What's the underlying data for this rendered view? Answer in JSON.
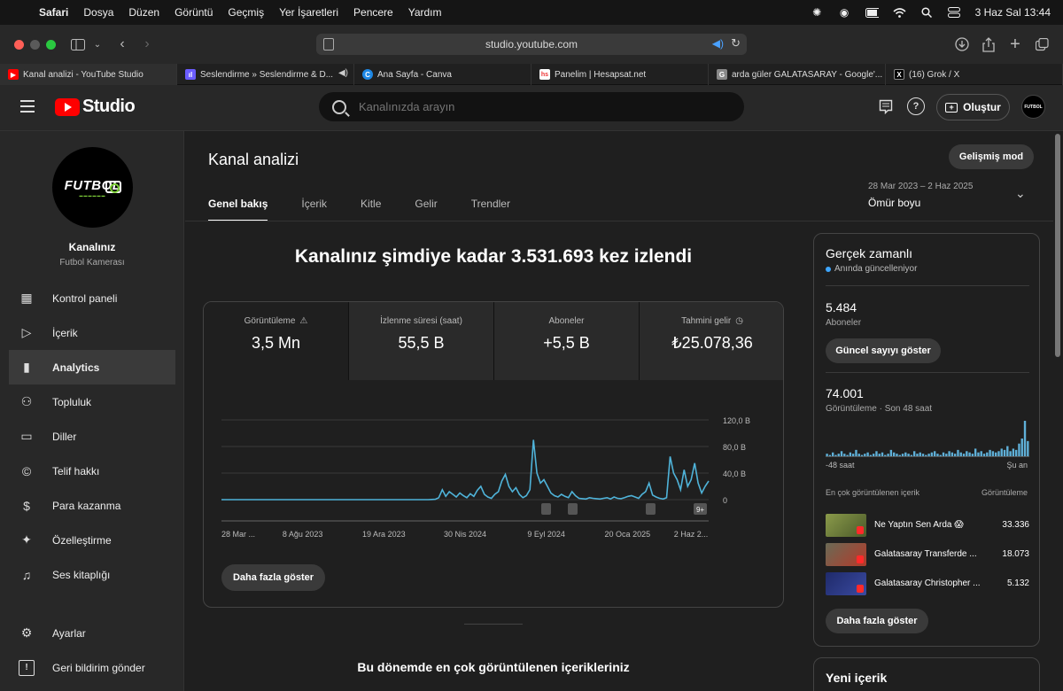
{
  "menubar": {
    "app": "Safari",
    "items": [
      "Dosya",
      "Düzen",
      "Görüntü",
      "Geçmiş",
      "Yer İşaretleri",
      "Pencere",
      "Yardım"
    ],
    "datetime": "3 Haz Sal  13:44"
  },
  "safari": {
    "url": "studio.youtube.com"
  },
  "tabs": [
    {
      "title": "Kanal analizi - YouTube Studio",
      "icon": "youtube-favicon",
      "color": "#ff0000",
      "glyph": "▶"
    },
    {
      "title": "Seslendirme » Seslendirme & D...",
      "icon": "audio-favicon",
      "color": "#6b5cff",
      "glyph": "ıl"
    },
    {
      "title": "Ana Sayfa - Canva",
      "icon": "canva-favicon",
      "color": "#1e88e5",
      "glyph": "C"
    },
    {
      "title": "Panelim | Hesapsat.net",
      "icon": "hesapsat-favicon",
      "color": "#ffffff",
      "glyph": "hs"
    },
    {
      "title": "arda güler GALATASARAY - Google'...",
      "icon": "google-favicon",
      "color": "#888888",
      "glyph": "G"
    },
    {
      "title": "(16) Grok / X",
      "icon": "x-favicon",
      "color": "#000000",
      "glyph": "X"
    }
  ],
  "header": {
    "logo_text": "Studio",
    "search_placeholder": "Kanalınızda arayın",
    "create_label": "Oluştur"
  },
  "sidebar": {
    "channel_name": "Kanalınız",
    "channel_sub": "Futbol Kamerası",
    "avatar_text": "FUTBOL",
    "nav": [
      {
        "label": "Kontrol paneli",
        "icon": "dashboard-icon",
        "glyph": "▦",
        "active": false
      },
      {
        "label": "İçerik",
        "icon": "content-icon",
        "glyph": "▷",
        "active": false
      },
      {
        "label": "Analytics",
        "icon": "analytics-icon",
        "glyph": "▮",
        "active": true
      },
      {
        "label": "Topluluk",
        "icon": "community-icon",
        "glyph": "⚇",
        "active": false
      },
      {
        "label": "Diller",
        "icon": "subtitles-icon",
        "glyph": "▭",
        "active": false
      },
      {
        "label": "Telif hakkı",
        "icon": "copyright-icon",
        "glyph": "©",
        "active": false
      },
      {
        "label": "Para kazanma",
        "icon": "dollar-icon",
        "glyph": "$",
        "active": false
      },
      {
        "label": "Özelleştirme",
        "icon": "magic-wand-icon",
        "glyph": "✦",
        "active": false
      },
      {
        "label": "Ses kitaplığı",
        "icon": "audio-library-icon",
        "glyph": "♫",
        "active": false
      },
      {
        "label": "Ayarlar",
        "icon": "settings-icon",
        "glyph": "⚙",
        "active": false
      },
      {
        "label": "Geri bildirim gönder",
        "icon": "feedback-icon",
        "glyph": "!",
        "active": false
      }
    ]
  },
  "main": {
    "title": "Kanal analizi",
    "advanced_mode": "Gelişmiş mod",
    "subtabs": [
      "Genel bakış",
      "İçerik",
      "Kitle",
      "Gelir",
      "Trendler"
    ],
    "date_range_small": "28 Mar 2023 – 2 Haz 2025",
    "date_range_big": "Ömür boyu",
    "headline": "Kanalınız şimdiye kadar 3.531.693 kez izlendi",
    "metrics": [
      {
        "label": "Görüntüleme",
        "value": "3,5 Mn",
        "icon": "warning-icon",
        "glyph": "⚠"
      },
      {
        "label": "İzlenme süresi (saat)",
        "value": "55,5 B",
        "icon": "",
        "glyph": ""
      },
      {
        "label": "Aboneler",
        "value": "+5,5 B",
        "icon": "",
        "glyph": ""
      },
      {
        "label": "Tahmini gelir",
        "value": "₺25.078,36",
        "icon": "clock-icon",
        "glyph": "◷"
      }
    ],
    "more_button": "Daha fazla göster",
    "bottom_title": "Bu dönemde en çok görüntülenen içerikleriniz"
  },
  "chart_data": {
    "type": "line",
    "x_tick_labels": [
      "28 Mar ...",
      "8 Ağu 2023",
      "19 Ara 2023",
      "30 Nis 2024",
      "9 Eyl 2024",
      "20 Oca 2025",
      "2 Haz 2..."
    ],
    "y_tick_labels": [
      "120,0 B",
      "80,0 B",
      "40,0 B",
      "0"
    ],
    "ylim": [
      0,
      120000
    ],
    "grid": true,
    "series": [
      {
        "color": "#4fb3d9",
        "values": [
          0,
          0,
          0,
          0,
          0,
          0,
          0,
          0,
          0,
          0,
          0,
          0,
          0,
          0,
          0,
          0,
          0,
          0,
          0,
          0,
          0,
          0,
          0,
          0,
          0,
          0,
          0,
          0,
          0,
          0,
          0,
          0,
          0,
          0,
          0,
          0,
          0,
          0,
          0,
          0,
          0,
          0,
          0,
          0,
          0,
          0,
          0,
          0,
          0,
          0,
          0,
          0,
          0,
          0,
          0,
          0,
          0,
          0,
          0,
          0,
          200,
          500,
          3000,
          15000,
          5000,
          12000,
          8000,
          4000,
          10000,
          6000,
          3000,
          9000,
          5000,
          14000,
          20000,
          8000,
          4000,
          2000,
          8000,
          12000,
          28000,
          38000,
          20000,
          12000,
          18000,
          8000,
          3000,
          6000,
          15000,
          90000,
          40000,
          25000,
          30000,
          20000,
          10000,
          6000,
          4000,
          8000,
          5000,
          3000,
          12000,
          6000,
          2000,
          1500,
          1000,
          3000,
          2000,
          1500,
          1000,
          2000,
          3000,
          1000,
          4000,
          2000,
          1500,
          3000,
          5000,
          6000,
          4000,
          2000,
          8000,
          12000,
          25000,
          7000,
          4000,
          2000,
          1000,
          3000,
          65000,
          40000,
          30000,
          15000,
          45000,
          20000,
          30000,
          55000,
          25000,
          10000,
          20000,
          28000
        ]
      }
    ],
    "annotation_count_label": "9+"
  },
  "realtime": {
    "title": "Gerçek zamanlı",
    "live_label": "Anında güncelleniyor",
    "subs_value": "5.484",
    "subs_label": "Aboneler",
    "show_count_button": "Güncel sayıyı göster",
    "views_value": "74.001",
    "views_label": "Görüntüleme · Son 48 saat",
    "axis_left": "-48 saat",
    "axis_right": "Şu an",
    "bars": [
      2,
      1,
      3,
      1,
      2,
      4,
      2,
      1,
      3,
      2,
      5,
      2,
      1,
      2,
      3,
      1,
      2,
      4,
      2,
      3,
      1,
      2,
      5,
      3,
      2,
      1,
      2,
      3,
      2,
      1,
      4,
      2,
      3,
      2,
      1,
      2,
      3,
      4,
      2,
      1,
      3,
      2,
      4,
      3,
      2,
      5,
      3,
      2,
      4,
      3,
      2,
      6,
      3,
      4,
      2,
      3,
      5,
      4,
      3,
      4,
      6,
      5,
      8,
      4,
      6,
      5,
      10,
      14,
      28,
      12
    ],
    "top_header_left": "En çok görüntülenen içerik",
    "top_header_right": "Görüntüleme",
    "top_items": [
      {
        "title": "Ne Yaptın Sen Arda 😱",
        "views": "33.336",
        "thumb": "#6b7a3a"
      },
      {
        "title": "Galatasaray Transferde ...",
        "views": "18.073",
        "thumb": "#4a4a40"
      },
      {
        "title": "Galatasaray Christopher ...",
        "views": "5.132",
        "thumb": "#2a3a7a"
      }
    ],
    "more_button": "Daha fazla göster",
    "new_content_title": "Yeni içerik"
  }
}
